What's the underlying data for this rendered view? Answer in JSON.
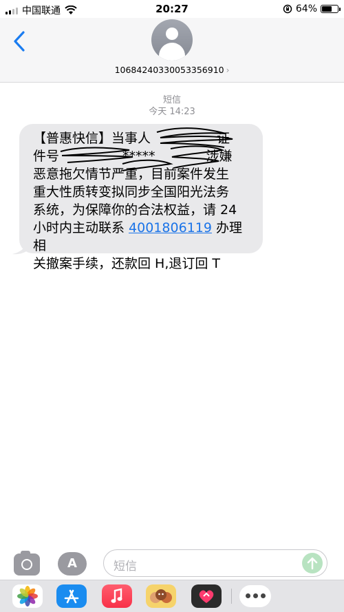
{
  "status_bar": {
    "carrier": "中国联通",
    "time": "20:27",
    "battery_text": "64%",
    "battery_level": 0.64,
    "icons": [
      "signal-icon",
      "wifi-icon",
      "orientation-lock-icon",
      "battery-icon"
    ]
  },
  "header": {
    "sender_number": "10684240330053356910",
    "chevron": "›"
  },
  "meta": {
    "message_type": "短信",
    "timestamp": "今天 14:23"
  },
  "message": {
    "line1": "【普惠快信】当事人",
    "line1_tail": "证",
    "line2": "件号",
    "line2_mid": "*****",
    "line2_tail": "涉嫌",
    "line3": "恶意拖欠情节严重，目前案件发生",
    "line4": "重大性质转变拟同步全国阳光法务",
    "line5": "系统，为保障你的合法权益，请 24",
    "line6_pre": "小时内主动联系 ",
    "phone": "4001806119",
    "line6_post": " 办理相",
    "line7": "关撤案手续，还款回 H,退订回 T"
  },
  "input_bar": {
    "placeholder": "短信",
    "appstore_glyph": "A"
  },
  "colors": {
    "link": "#1a73e8",
    "bubble": "#e9e9eb",
    "back_arrow": "#1a7cf0",
    "send": "#b8e3c1"
  }
}
